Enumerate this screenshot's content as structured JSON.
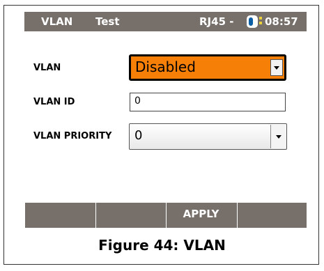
{
  "status_bar": {
    "title": "VLAN",
    "mode": "Test",
    "port": "RJ45 -",
    "time": "08:57",
    "battery_icon": "battery-icon"
  },
  "form": {
    "vlan": {
      "label": "VLAN",
      "value": "Disabled"
    },
    "vlan_id": {
      "label": "VLAN ID",
      "value": "0"
    },
    "vlan_priority": {
      "label": "VLAN PRIORITY",
      "value": "0"
    }
  },
  "softkeys": [
    "",
    "",
    "APPLY",
    ""
  ],
  "caption": "Figure 44: VLAN",
  "colors": {
    "bar": "#766f6a",
    "selected_field": "#f57f07",
    "battery": "#0b5fa6"
  }
}
